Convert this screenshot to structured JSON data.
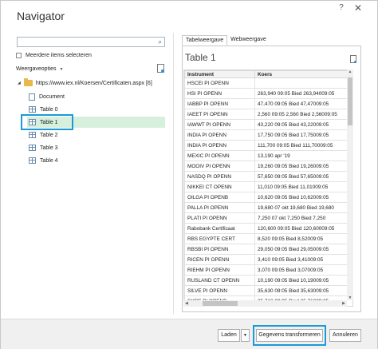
{
  "window": {
    "title": "Navigator",
    "help_label": "?",
    "close_label": "✕"
  },
  "left": {
    "search_placeholder": "",
    "multi_select_label": "Meerdere items selecteren",
    "view_options_label": "Weergaveopties",
    "root": {
      "label": "https://www.iex.nl/Koersen/Certificaten.aspx [6]"
    },
    "items": [
      {
        "label": "Document",
        "icon": "document-icon"
      },
      {
        "label": "Table 0",
        "icon": "table-icon"
      },
      {
        "label": "Table 1",
        "icon": "table-icon",
        "selected": true
      },
      {
        "label": "Table 2",
        "icon": "table-icon"
      },
      {
        "label": "Table 3",
        "icon": "table-icon"
      },
      {
        "label": "Table 4",
        "icon": "table-icon"
      }
    ]
  },
  "right": {
    "tabs": [
      "Tabelweergave",
      "Webweergave"
    ],
    "active_tab": 0,
    "title": "Table 1",
    "columns": [
      "Instrument",
      "Koers"
    ],
    "rows": [
      [
        "HSCEI PI OPENN",
        ""
      ],
      [
        "HSI PI OPENN",
        "263,940 09:05 Bied 263,94009:05"
      ],
      [
        "IABBP PI OPENN",
        "47,470 09:05 Bied 47,47009:05"
      ],
      [
        "IAEET PI OPENN",
        "2,560 09:05 2,560 Bied 2,56009:05"
      ],
      [
        "IAWWT PI OPENN",
        "43,220 09:05 Bied 43,22009:05"
      ],
      [
        "INDIA PI OPENN",
        "17,750 09:05 Bied 17,75009:05"
      ],
      [
        "INDIA PI OPENN",
        "111,700 09:05 Bied 111,70009:05"
      ],
      [
        "MEXIC PI OPENN",
        "13,190 apr '19"
      ],
      [
        "MOOIV PI OPENN",
        "19,260 09:05 Bied 19,26009:05"
      ],
      [
        "NASDQ PI OPENN",
        "57,650 09:05 Bied 57,65009:05"
      ],
      [
        "NIKKEI CT OPENN",
        "11,010 09:05 Bied 11,01009:05"
      ],
      [
        "OILGA PI OPENB",
        "10,620 09:05 Bied 10,62009:05"
      ],
      [
        "PALLA PI OPENN",
        "19,680 07 okt 19,680 Bied 19,680"
      ],
      [
        "PLATI PI OPENN",
        "7,250 07 okt 7,250 Bied 7,250"
      ],
      [
        "Rabobank Certificaat",
        "120,600 09:05 Bied 120,60009:05"
      ],
      [
        "RBS EGYPTE CERT",
        "8,520 09:05 Bied 8,52009:05"
      ],
      [
        "RBSBI PI OPENN",
        "29,050 09:05 Bied 29,05009:05"
      ],
      [
        "RICEN PI OPENN",
        "3,410 09:05 Bied 3,41009:05"
      ],
      [
        "RIEHM PI OPENN",
        "3,070 09:05 Bied 3,07009:05"
      ],
      [
        "RUSLAND CT OPENN",
        "10,190 09:05 Bied 10,19009:05"
      ],
      [
        "SILVE PI OPENN",
        "35,630 09:05 Bied 35,63009:05"
      ],
      [
        "SXRE PI OPENB",
        "35.710 09:05 Bied 35,71009:05"
      ]
    ]
  },
  "footer": {
    "load_label": "Laden",
    "transform_label": "Gegevens transformeren",
    "cancel_label": "Annuleren"
  },
  "colors": {
    "highlight": "#1b9bd6",
    "selected_bg": "#d7f0dd"
  }
}
